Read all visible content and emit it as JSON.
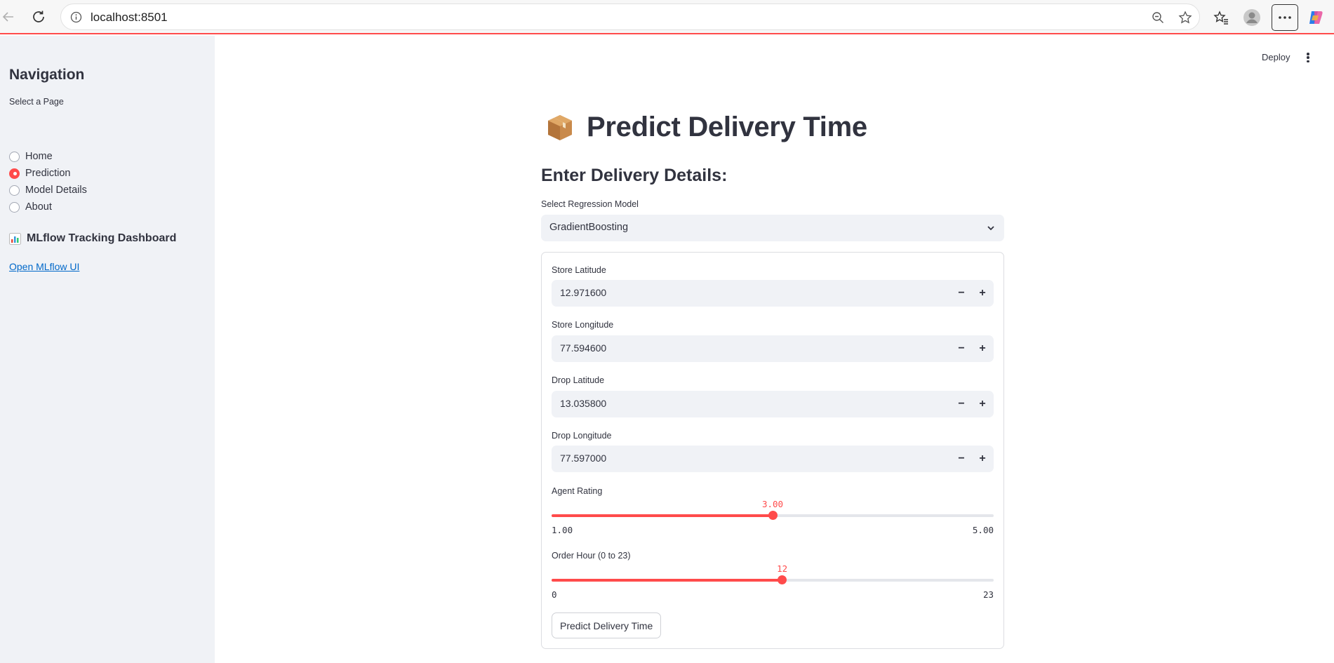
{
  "browser": {
    "url": "localhost:8501"
  },
  "sidebar": {
    "title": "Navigation",
    "select_label": "Select a Page",
    "pages": [
      {
        "label": "Home",
        "checked": false
      },
      {
        "label": "Prediction",
        "checked": true
      },
      {
        "label": "Model Details",
        "checked": false
      },
      {
        "label": "About",
        "checked": false
      }
    ],
    "subheader": "MLflow Tracking Dashboard",
    "link_label": "Open MLflow UI"
  },
  "header": {
    "deploy_label": "Deploy"
  },
  "main": {
    "title": "Predict Delivery Time",
    "section_title": "Enter Delivery Details:",
    "model_select": {
      "label": "Select Regression Model",
      "value": "GradientBoosting"
    },
    "inputs": [
      {
        "label": "Store Latitude",
        "value": "12.971600"
      },
      {
        "label": "Store Longitude",
        "value": "77.594600"
      },
      {
        "label": "Drop Latitude",
        "value": "13.035800"
      },
      {
        "label": "Drop Longitude",
        "value": "77.597000"
      }
    ],
    "sliders": [
      {
        "label": "Agent Rating",
        "value": "3.00",
        "min": "1.00",
        "max": "5.00",
        "fraction": 0.5
      },
      {
        "label": "Order Hour (0 to 23)",
        "value": "12",
        "min": "0",
        "max": "23",
        "fraction": 0.5217
      }
    ],
    "predict_button": "Predict Delivery Time"
  },
  "colors": {
    "accent": "#ff4b4b",
    "sidebar_bg": "#f0f2f6",
    "text": "#31333f",
    "link": "#0068c9"
  }
}
